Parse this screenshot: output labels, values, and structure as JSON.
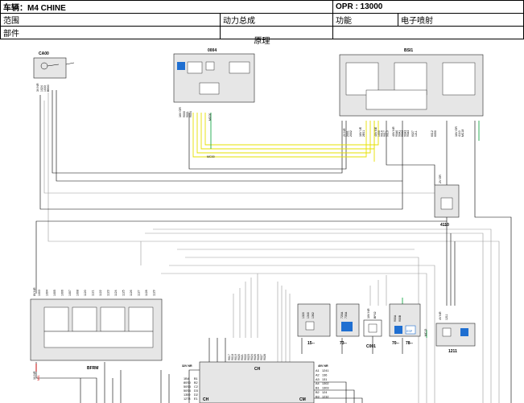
{
  "header": {
    "vehicle": "车辆：M4 CHINE",
    "opr": "OPR : 13000",
    "scope_label": "范围",
    "assembly": "动力总成",
    "function_label": "功能",
    "function_value": "电子喷射",
    "parts_label": "部件"
  },
  "diagram": {
    "title": "原理",
    "components": {
      "ca00": "CA00",
      "c0004": "0004",
      "bsi1": "BSI1",
      "c4110": "4110",
      "bfrm": "BFRM",
      "c15": "15--",
      "c73": "73--",
      "c001": "C001",
      "c70": "70--",
      "c78": "78--",
      "c1211": "1211",
      "ch_top": "CH",
      "ch_left": "CH",
      "cm_right": "CM",
      "esp_label": "ESP"
    },
    "connectors": {
      "ca00_pin": "3V NR",
      "c0004_pin": "16V GR",
      "bsi1_a": "2V NR",
      "bsi1_b": "16V VE",
      "bsi1_c": "40V BE",
      "bsi1_d": "40V NR",
      "bsi1_e": "16V GR",
      "c4110_pin": "2V GR",
      "c4110_wires": [
        "4110"
      ],
      "bfrm_pin": "8V NR",
      "bfrm_bottom_pin": "1V NR",
      "c001_pin": "10V NR",
      "c1211_pin": "4V NR",
      "ch_pin": "32V NR",
      "cm_pin": "40V NR"
    },
    "wire_labels": {
      "ca00": [
        "1024",
        "1033",
        "BB00"
      ],
      "c0004": [
        "9000",
        "9001",
        "9004"
      ],
      "c0004_green": [
        "MC00"
      ],
      "c0004_bottom": "MC00",
      "bsi1_nr": [
        "2001",
        "2002"
      ],
      "bsi1_ve": [
        "2E01"
      ],
      "bsi1_be": [
        "1050",
        "9016",
        "9017",
        "9019"
      ],
      "bsi1_nr2": [
        "90A0",
        "90A1",
        "90A2",
        "90A3",
        "90A4"
      ],
      "bsi1_mid": [
        "6027",
        "1211"
      ],
      "bsi1_right": [
        "6012",
        "6050"
      ],
      "bsi1_gr": [
        "4110",
        "MC18"
      ],
      "bfrm_top": [
        "1003",
        "1004",
        "1005",
        "1006",
        "1007",
        "1008",
        "1120",
        "1121",
        "1122",
        "1123",
        "1124",
        "1125",
        "1126",
        "1127",
        "1128",
        "1129"
      ],
      "bfrm_bottom": "M01",
      "mid_bundle": [
        "9017",
        "9018",
        "9019",
        "9020",
        "9021",
        "9022",
        "9023",
        "9024",
        "9025",
        "9026",
        "9027",
        "9028"
      ],
      "c15": [
        "1320",
        "1340",
        "1362"
      ],
      "c73": [
        "720A",
        "730A"
      ],
      "c001": [
        "BP02"
      ],
      "c70": [
        "900A",
        "900B"
      ],
      "c78": [
        "MC15"
      ],
      "c1211": [
        "1211"
      ],
      "ch_left_pins": [
        "1B4",
        "80S0",
        "50S3",
        "50S4",
        "1359",
        "1278"
      ],
      "ch_left_pin_ids": [
        "B1",
        "B2",
        "C2",
        "D3",
        "D2",
        "E1"
      ],
      "cm_right_pins": [
        "1241",
        "136",
        "131",
        "1302",
        "1303",
        "124",
        "1232"
      ],
      "cm_right_pin_ids": [
        "A1",
        "A2",
        "A3",
        "A4",
        "B1",
        "B2",
        "B3"
      ]
    },
    "colors": {
      "wire": "#000000",
      "grey_wire": "#9a9a9a",
      "yellow_wire": "#e6e000",
      "green_wire": "#1aa84a",
      "red_wire": "#d00000",
      "box_fill": "#e6e6e6",
      "box_stroke": "#222222",
      "blue_icon": "#1f6fd1"
    }
  }
}
